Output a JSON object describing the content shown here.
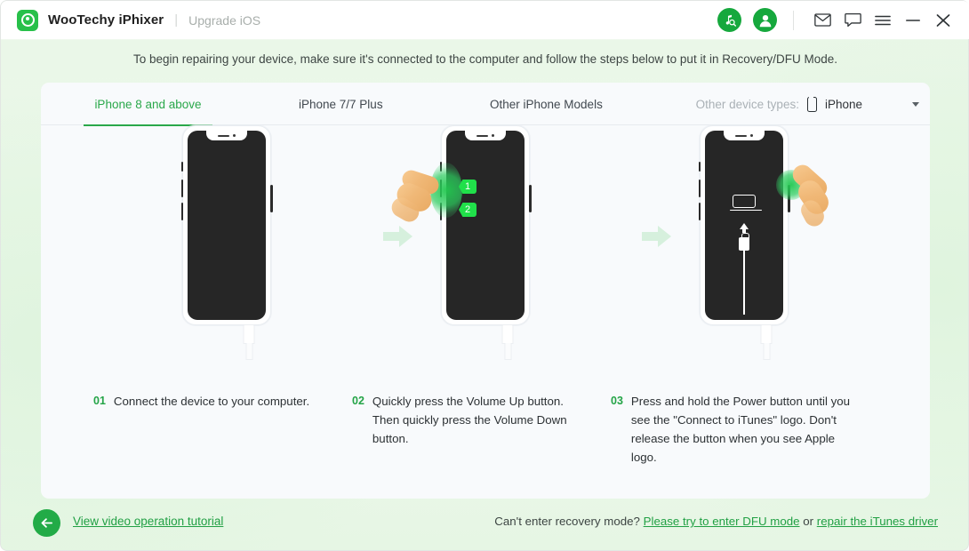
{
  "titlebar": {
    "logo_icon": "wootechy-logo-icon",
    "brand": "WooTechy iPhixer",
    "separator": "|",
    "subtitle": "Upgrade iOS",
    "icons": [
      {
        "name": "itunes-search-icon",
        "glyph": "♫"
      },
      {
        "name": "user-account-icon",
        "glyph": "👤"
      },
      {
        "name": "mail-icon",
        "glyph": "✉"
      },
      {
        "name": "feedback-icon",
        "glyph": "💬"
      },
      {
        "name": "menu-icon",
        "glyph": "☰"
      },
      {
        "name": "minimize-icon",
        "glyph": "−"
      },
      {
        "name": "close-icon",
        "glyph": "✕"
      }
    ]
  },
  "headline": "To begin repairing your device, make sure it's connected to the computer and follow the steps below to put it in Recovery/DFU Mode.",
  "tabs": [
    {
      "label": "iPhone 8 and above",
      "active": true
    },
    {
      "label": "iPhone 7/7 Plus",
      "active": false
    },
    {
      "label": "Other iPhone Models",
      "active": false
    }
  ],
  "device_select": {
    "label": "Other device types:",
    "value": "iPhone",
    "icon": "phone-icon",
    "caret": "chevron-down-icon"
  },
  "steps": [
    {
      "num": "01",
      "text": "Connect the device to your computer."
    },
    {
      "num": "02",
      "text": "Quickly press the Volume Up button. Then quickly press the Volume Down button."
    },
    {
      "num": "03",
      "text": "Press and hold the Power button until you see the \"Connect to iTunes\" logo. Don't release the button when you see Apple logo."
    }
  ],
  "badges": {
    "first": "1",
    "second": "2"
  },
  "bottom": {
    "back_icon": "back-arrow-icon",
    "tutorial_link": "View video operation tutorial",
    "question": "Can't enter recovery mode?",
    "dfu_link": "Please try to enter DFU mode",
    "conjunction": "or",
    "itunes_link": "repair the iTunes driver"
  },
  "colors": {
    "brand_green": "#28c04a",
    "accent_green": "#21a044",
    "tab_active": "#2aa84a",
    "badge_green": "#20e04a",
    "arrow_green": "#d6f0dd",
    "screen_dark": "#262626",
    "card_bg": "#f8fafc"
  }
}
